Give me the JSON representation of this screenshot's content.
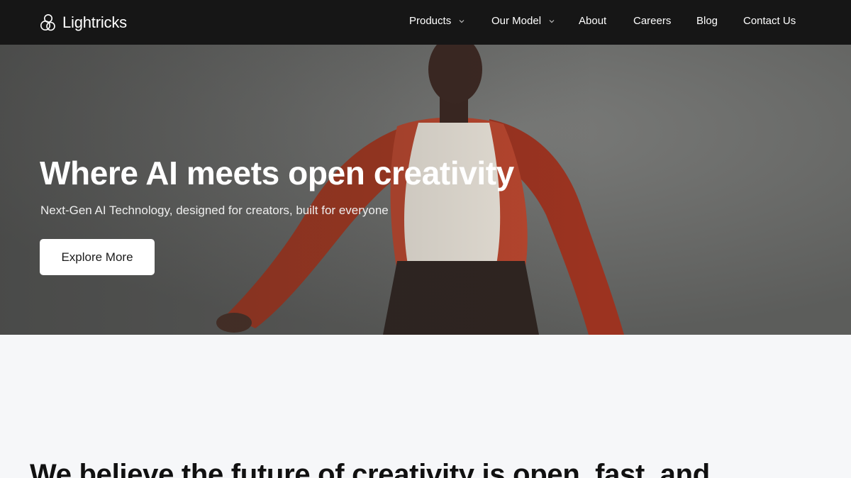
{
  "brand": {
    "name": "Lightricks",
    "icon": "lightricks-logo-icon"
  },
  "nav": {
    "items": [
      {
        "label": "Products",
        "has_dropdown": true
      },
      {
        "label": "Our Model",
        "has_dropdown": true
      },
      {
        "label": "About",
        "has_dropdown": false
      },
      {
        "label": "Careers",
        "has_dropdown": false
      },
      {
        "label": "Blog",
        "has_dropdown": false
      },
      {
        "label": "Contact Us",
        "has_dropdown": false
      }
    ]
  },
  "hero": {
    "title": "Where AI meets open creativity",
    "subtitle": "Next-Gen AI Technology, designed for creators, built for everyone",
    "cta_label": "Explore More"
  },
  "section": {
    "heading": "We believe the future of creativity is open, fast, and"
  },
  "colors": {
    "nav_bg": "#161616",
    "page_bg": "#f6f7f9",
    "jacket_red": "#b23a26",
    "text_light": "#ffffff"
  }
}
